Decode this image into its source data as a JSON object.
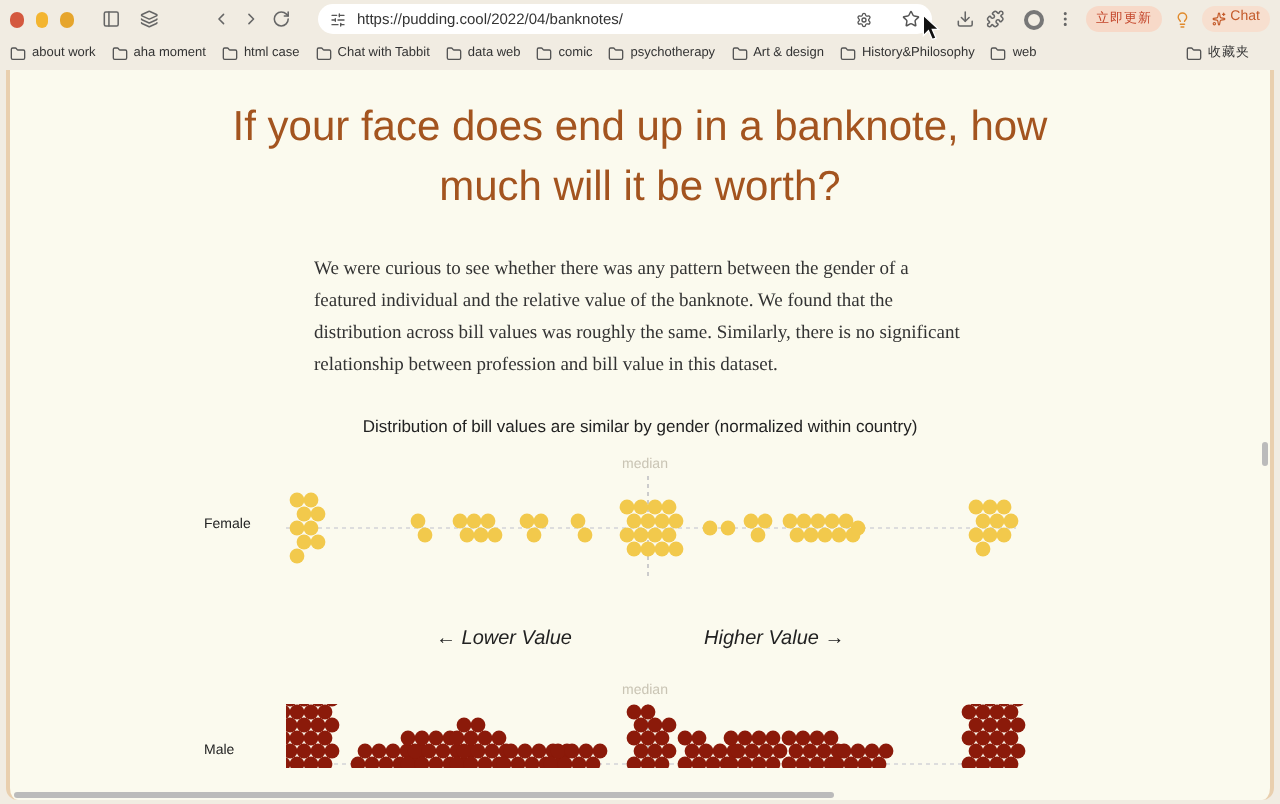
{
  "browser": {
    "url": "https://pudding.cool/2022/04/banknotes/",
    "update_button": "立即更新",
    "chat_button": "Chat",
    "bookmarks": [
      "about work",
      "aha moment",
      "html case",
      "Chat with Tabbit",
      "data web",
      "comic",
      "psychotherapy",
      "Art & design",
      "History&Philosophy",
      "web"
    ],
    "other_bookmarks": "收藏夹"
  },
  "article": {
    "title": "If your face does end up in a banknote, how much will it be worth?",
    "paragraph": "We were curious to see whether there was any pattern between the gender of a featured individual and the relative value of the banknote. We found that the distribution across bill values was roughly the same. Similarly, there is no significant relationship between profession and bill value in this dataset.",
    "chart_title": "Distribution of bill values are similar by gender (normalized within country)",
    "female": {
      "kind": "female",
      "label": "Female",
      "median_label": "median"
    },
    "axis": {
      "lower": "← Lower Value",
      "higher": "Higher Value →"
    },
    "male": {
      "kind": "male",
      "label": "Male",
      "median_label": "median"
    }
  }
}
